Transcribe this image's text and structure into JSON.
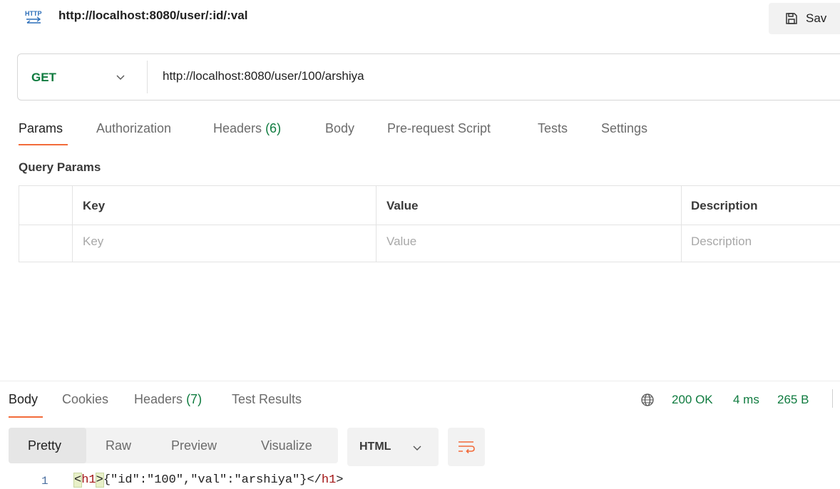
{
  "request": {
    "title": "http://localhost:8080/user/:id/:val",
    "save_label": "Sav",
    "method": "GET",
    "url": "http://localhost:8080/user/100/arshiya"
  },
  "request_tabs": [
    {
      "label": "Params",
      "active": true
    },
    {
      "label": "Authorization"
    },
    {
      "label": "Headers",
      "count": "(6)"
    },
    {
      "label": "Body"
    },
    {
      "label": "Pre-request Script"
    },
    {
      "label": "Tests"
    },
    {
      "label": "Settings"
    }
  ],
  "params": {
    "section_title": "Query Params",
    "headers": [
      "Key",
      "Value",
      "Description"
    ],
    "placeholders": [
      "Key",
      "Value",
      "Description"
    ]
  },
  "response": {
    "tabs": [
      {
        "label": "Body",
        "active": true
      },
      {
        "label": "Cookies"
      },
      {
        "label": "Headers",
        "count": "(7)"
      },
      {
        "label": "Test Results"
      }
    ],
    "status": "200 OK",
    "time": "4 ms",
    "size": "265 B",
    "views": [
      "Pretty",
      "Raw",
      "Preview",
      "Visualize"
    ],
    "active_view": "Pretty",
    "format": "HTML",
    "code_lines": [
      {
        "number": "1",
        "open_lt": "<",
        "open_tag": "h1",
        "open_gt": ">",
        "content": "{\"id\":\"100\",\"val\":\"arshiya\"}",
        "close_tag": "</h1>"
      }
    ]
  },
  "colors": {
    "accent": "#f26b3a",
    "success": "#0f7b3f",
    "method_get": "#0f7b3f"
  },
  "icons": [
    "http-icon",
    "save-icon",
    "chevron-down-icon",
    "globe-icon",
    "wrap-lines-icon"
  ]
}
